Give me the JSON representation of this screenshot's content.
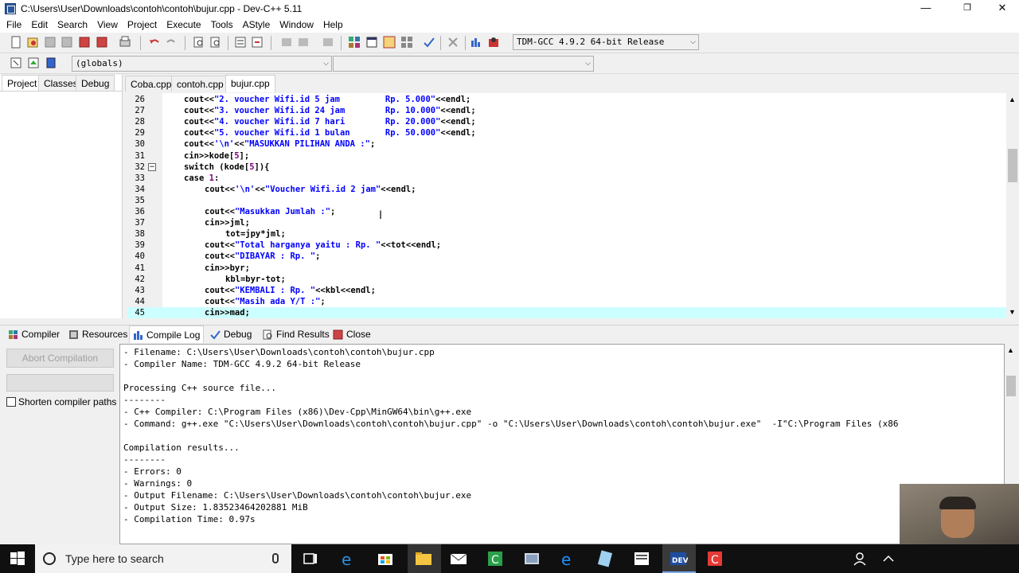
{
  "window": {
    "title": "C:\\Users\\User\\Downloads\\contoh\\contoh\\bujur.cpp - Dev-C++ 5.11",
    "minimize": "—",
    "restore": "❐",
    "close": "✕"
  },
  "menu": [
    "File",
    "Edit",
    "Search",
    "View",
    "Project",
    "Execute",
    "Tools",
    "AStyle",
    "Window",
    "Help"
  ],
  "toolbar": {
    "compiler_select": "TDM-GCC 4.9.2 64-bit Release",
    "globals_select": "(globals)",
    "function_select": ""
  },
  "left_tabs": [
    "Project",
    "Classes",
    "Debug"
  ],
  "file_tabs": [
    "Coba.cpp",
    "contoh.cpp",
    "bujur.cpp"
  ],
  "editor": {
    "lines": [
      {
        "n": "26",
        "indent": 0,
        "parts": [
          [
            "p",
            "cout<<"
          ],
          [
            "s",
            "\"2. voucher Wifi.id 5 jam         Rp. 5.000\""
          ],
          [
            "p",
            "<<endl;"
          ]
        ]
      },
      {
        "n": "27",
        "indent": 0,
        "parts": [
          [
            "p",
            "cout<<"
          ],
          [
            "s",
            "\"3. voucher Wifi.id 24 jam        Rp. 10.000\""
          ],
          [
            "p",
            "<<endl;"
          ]
        ]
      },
      {
        "n": "28",
        "indent": 0,
        "parts": [
          [
            "p",
            "cout<<"
          ],
          [
            "s",
            "\"4. voucher Wifi.id 7 hari        Rp. 20.000\""
          ],
          [
            "p",
            "<<endl;"
          ]
        ]
      },
      {
        "n": "29",
        "indent": 0,
        "parts": [
          [
            "p",
            "cout<<"
          ],
          [
            "s",
            "\"5. voucher Wifi.id 1 bulan       Rp. 50.000\""
          ],
          [
            "p",
            "<<endl;"
          ]
        ]
      },
      {
        "n": "30",
        "indent": 0,
        "parts": [
          [
            "p",
            "cout<<"
          ],
          [
            "s",
            "'\\n'"
          ],
          [
            "p",
            "<<"
          ],
          [
            "s",
            "\"MASUKKAN PILIHAN ANDA :\""
          ],
          [
            "p",
            ";"
          ]
        ]
      },
      {
        "n": "31",
        "indent": 0,
        "parts": [
          [
            "p",
            "cin>>kode["
          ],
          [
            "m",
            "5"
          ],
          [
            "p",
            "];"
          ]
        ]
      },
      {
        "n": "32",
        "indent": 0,
        "fold": true,
        "parts": [
          [
            "p",
            "switch (kode["
          ],
          [
            "m",
            "5"
          ],
          [
            "p",
            "]){"
          ]
        ]
      },
      {
        "n": "33",
        "indent": 0,
        "parts": [
          [
            "p",
            "case "
          ],
          [
            "m",
            "1"
          ],
          [
            "p",
            ":"
          ]
        ]
      },
      {
        "n": "34",
        "indent": 1,
        "parts": [
          [
            "p",
            "cout<<"
          ],
          [
            "s",
            "'\\n'"
          ],
          [
            "p",
            "<<"
          ],
          [
            "s",
            "\"Voucher Wifi.id 2 jam\""
          ],
          [
            "p",
            "<<endl;"
          ]
        ]
      },
      {
        "n": "35",
        "indent": 1,
        "parts": []
      },
      {
        "n": "36",
        "indent": 1,
        "parts": [
          [
            "p",
            "cout<<"
          ],
          [
            "s",
            "\"Masukkan Jumlah :\""
          ],
          [
            "p",
            ";"
          ]
        ]
      },
      {
        "n": "37",
        "indent": 1,
        "parts": [
          [
            "p",
            "cin>>jml;"
          ]
        ]
      },
      {
        "n": "38",
        "indent": 2,
        "parts": [
          [
            "p",
            "tot=jpy*jml;"
          ]
        ]
      },
      {
        "n": "39",
        "indent": 1,
        "parts": [
          [
            "p",
            "cout<<"
          ],
          [
            "s",
            "\"Total harganya yaitu : Rp. \""
          ],
          [
            "p",
            "<<tot<<endl;"
          ]
        ]
      },
      {
        "n": "40",
        "indent": 1,
        "parts": [
          [
            "p",
            "cout<<"
          ],
          [
            "s",
            "\"DIBAYAR : Rp. \""
          ],
          [
            "p",
            ";"
          ]
        ]
      },
      {
        "n": "41",
        "indent": 1,
        "parts": [
          [
            "p",
            "cin>>byr;"
          ]
        ]
      },
      {
        "n": "42",
        "indent": 2,
        "parts": [
          [
            "p",
            "kbl=byr-tot;"
          ]
        ]
      },
      {
        "n": "43",
        "indent": 1,
        "parts": [
          [
            "p",
            "cout<<"
          ],
          [
            "s",
            "\"KEMBALI : Rp. \""
          ],
          [
            "p",
            "<<kbl<<endl;"
          ]
        ]
      },
      {
        "n": "44",
        "indent": 1,
        "parts": [
          [
            "p",
            "cout<<"
          ],
          [
            "s",
            "\"Masih ada Y/T :\""
          ],
          [
            "p",
            ";"
          ]
        ]
      },
      {
        "n": "45",
        "indent": 1,
        "current": true,
        "parts": [
          [
            "p",
            "cin>>mad;"
          ]
        ]
      }
    ]
  },
  "bottom_tabs": [
    "Compiler",
    "Resources",
    "Compile Log",
    "Debug",
    "Find Results",
    "Close"
  ],
  "left_panel": {
    "abort_button": "Abort Compilation",
    "shorten_label": "Shorten compiler paths"
  },
  "log_lines": [
    "- Filename: C:\\Users\\User\\Downloads\\contoh\\contoh\\bujur.cpp",
    "- Compiler Name: TDM-GCC 4.9.2 64-bit Release",
    "",
    "Processing C++ source file...",
    "--------",
    "- C++ Compiler: C:\\Program Files (x86)\\Dev-Cpp\\MinGW64\\bin\\g++.exe",
    "- Command: g++.exe \"C:\\Users\\User\\Downloads\\contoh\\contoh\\bujur.cpp\" -o \"C:\\Users\\User\\Downloads\\contoh\\contoh\\bujur.exe\"  -I\"C:\\Program Files (x86",
    "",
    "Compilation results...",
    "--------",
    "- Errors: 0",
    "- Warnings: 0",
    "- Output Filename: C:\\Users\\User\\Downloads\\contoh\\contoh\\bujur.exe",
    "- Output Size: 1.83523464202881 MiB",
    "- Compilation Time: 0.97s"
  ],
  "taskbar": {
    "search_placeholder": "Type here to search"
  }
}
